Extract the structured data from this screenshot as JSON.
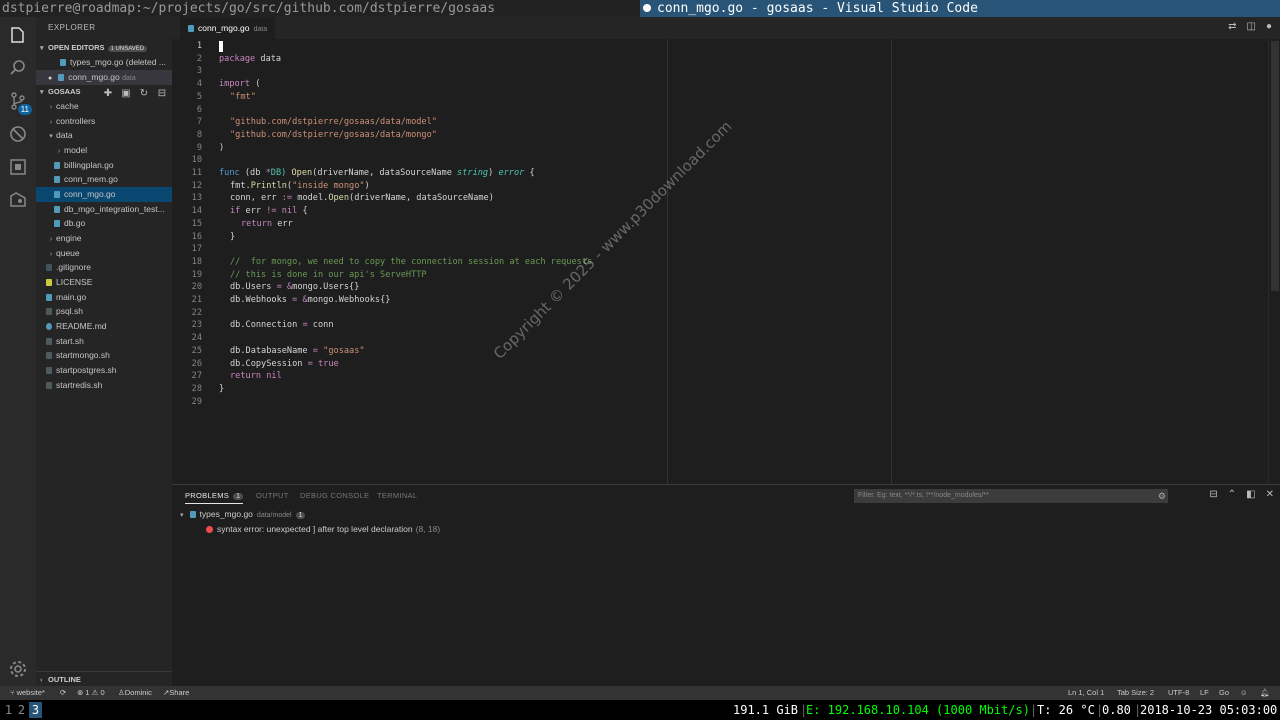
{
  "window": {
    "left_title": "dstpierre@roadmap:~/projects/go/src/github.com/dstpierre/gosaas",
    "right_title": "conn_mgo.go - gosaas - Visual Studio Code"
  },
  "activity": {
    "scm_badge": "11"
  },
  "sidebar": {
    "title": "EXPLORER",
    "open_editors": {
      "label": "OPEN EDITORS",
      "badge": "1 UNSAVED"
    },
    "open_files": [
      {
        "name": "types_mgo.go (deleted ...",
        "sub": ""
      },
      {
        "name": "conn_mgo.go",
        "sub": "data"
      }
    ],
    "project": "GOSAAS",
    "tree": [
      {
        "name": "cache",
        "kind": "folder"
      },
      {
        "name": "controllers",
        "kind": "folder"
      },
      {
        "name": "data",
        "kind": "folder-open"
      },
      {
        "name": "model",
        "kind": "folder"
      },
      {
        "name": "billingplan.go",
        "kind": "go"
      },
      {
        "name": "conn_mem.go",
        "kind": "go"
      },
      {
        "name": "conn_mgo.go",
        "kind": "go"
      },
      {
        "name": "db_mgo_integration_test...",
        "kind": "go"
      },
      {
        "name": "db.go",
        "kind": "go"
      },
      {
        "name": "engine",
        "kind": "folder"
      },
      {
        "name": "queue",
        "kind": "folder"
      },
      {
        "name": ".gitignore",
        "kind": "git"
      },
      {
        "name": "LICENSE",
        "kind": "lic"
      },
      {
        "name": "main.go",
        "kind": "go"
      },
      {
        "name": "psql.sh",
        "kind": "sh"
      },
      {
        "name": "README.md",
        "kind": "md"
      },
      {
        "name": "start.sh",
        "kind": "sh"
      },
      {
        "name": "startmongo.sh",
        "kind": "sh"
      },
      {
        "name": "startpostgres.sh",
        "kind": "sh"
      },
      {
        "name": "startredis.sh",
        "kind": "sh"
      }
    ],
    "outline": "OUTLINE"
  },
  "editor": {
    "tab": {
      "name": "conn_mgo.go",
      "sub": "data"
    },
    "lines": [
      "1",
      "2",
      "3",
      "4",
      "5",
      "6",
      "7",
      "8",
      "9",
      "10",
      "11",
      "12",
      "13",
      "14",
      "15",
      "16",
      "17",
      "18",
      "19",
      "20",
      "21",
      "22",
      "23",
      "24",
      "25",
      "26",
      "27",
      "28",
      "29"
    ],
    "code": {
      "l2a": "package",
      "l2b": " data",
      "l4a": "import",
      "l4b": " (",
      "l5": "\"fmt\"",
      "l7": "\"github.com/dstpierre/gosaas/data/model\"",
      "l8": "\"github.com/dstpierre/gosaas/data/mongo\"",
      "l9": ")",
      "l11a": "func",
      "l11b": " (db ",
      "l11c": "*",
      "l11d": "DB) ",
      "l11e": "Open",
      "l11f": "(driverName, dataSourceName ",
      "l11g": "string",
      "l11h": ") ",
      "l11i": "error",
      "l11j": " {",
      "l12a": "fmt.",
      "l12b": "Println",
      "l12c": "(",
      "l12d": "\"inside mongo\"",
      "l12e": ")",
      "l13a": "conn, err ",
      "l13b": ":=",
      "l13c": " model.",
      "l13d": "Open",
      "l13e": "(driverName, dataSourceName)",
      "l14a": "if",
      "l14b": " err ",
      "l14c": "!=",
      "l14d": " ",
      "l14e": "nil",
      "l14f": " {",
      "l15a": "return",
      "l15b": " err",
      "l16": "}",
      "l18": "//  for mongo, we need to copy the connection session at each requests",
      "l19": "// this is done in our api's ServeHTTP",
      "l20a": "db.Users ",
      "l20b": "=",
      "l20c": " ",
      "l20d": "&",
      "l20e": "mongo.Users{}",
      "l21a": "db.Webhooks ",
      "l21b": "=",
      "l21c": " ",
      "l21d": "&",
      "l21e": "mongo.Webhooks{}",
      "l23a": "db.Connection ",
      "l23b": "=",
      "l23c": " conn",
      "l25a": "db.DatabaseName ",
      "l25b": "=",
      "l25c": " ",
      "l25d": "\"gosaas\"",
      "l26a": "db.CopySession ",
      "l26b": "=",
      "l26c": " ",
      "l26d": "true",
      "l27a": "return",
      "l27b": " ",
      "l27c": "nil",
      "l28": "}"
    },
    "watermark": "Copyright © 2025 - www.p30download.com"
  },
  "panel": {
    "tabs": [
      "PROBLEMS",
      "OUTPUT",
      "DEBUG CONSOLE",
      "TERMINAL"
    ],
    "problems_count": "1",
    "filter_placeholder": "Filter. Eg: text, **/*.ts, !**/node_modules/**",
    "file": {
      "name": "types_mgo.go",
      "path": "data/model",
      "count": "1"
    },
    "error": {
      "message": "syntax error: unexpected ] after top level declaration",
      "loc": "(8, 18)"
    }
  },
  "statusbar": {
    "branch": "website*",
    "errors": "1",
    "warnings": "0",
    "user": "Dominic",
    "share": "Share",
    "position": "Ln 1, Col 1",
    "tabsize": "Tab Size: 2",
    "encoding": "UTF-8",
    "eol": "LF",
    "language": "Go"
  },
  "i3bar": {
    "workspaces": [
      "1",
      "2",
      "3"
    ],
    "disk": "191.1 GiB",
    "net": "E: 192.168.10.104 (1000 Mbit/s)",
    "temp": "T: 26 °C",
    "load": "0.80",
    "datetime": "2018-10-23 05:03:00"
  },
  "colors": {
    "accent": "#285577",
    "status_bg": "#333333",
    "editor_bg": "#1e1e1e"
  }
}
